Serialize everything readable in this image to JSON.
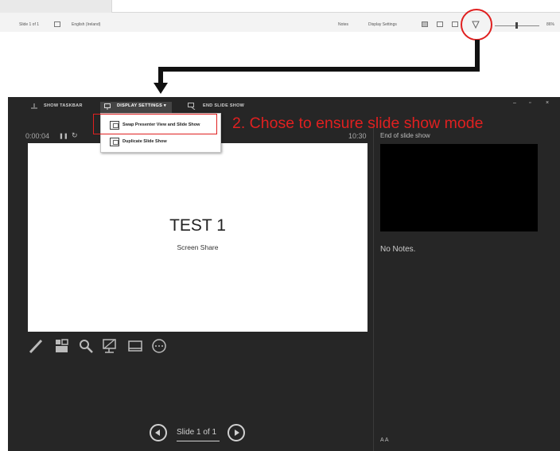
{
  "status_bar": {
    "slide_label": "Slide 1 of 1",
    "language": "English (Ireland)",
    "notes_label": "Notes",
    "display_settings_label": "Display Settings",
    "zoom_label": "86%"
  },
  "toolbar": {
    "show_taskbar": "SHOW TASKBAR",
    "display_settings": "DISPLAY SETTINGS ▾",
    "end_slide_show": "END SLIDE SHOW",
    "minimize": "–",
    "restore": "▫",
    "close": "×"
  },
  "dropdown": {
    "items": [
      {
        "label": "Swap Presenter View and Slide Show"
      },
      {
        "label": "Duplicate Slide Show"
      }
    ]
  },
  "annotation": "2. Chose to ensure slide show mode",
  "presenter": {
    "timer": "0:00:04",
    "clock": "10:30",
    "current_slide": {
      "title": "TEST 1",
      "subtitle": "Screen Share"
    },
    "next_label": "End of slide show",
    "notes": "No Notes.",
    "nav_label": "Slide 1 of 1",
    "font_sizes": "A  A"
  },
  "colors": {
    "annotation_red": "#e02020",
    "presenter_bg": "#262626"
  }
}
